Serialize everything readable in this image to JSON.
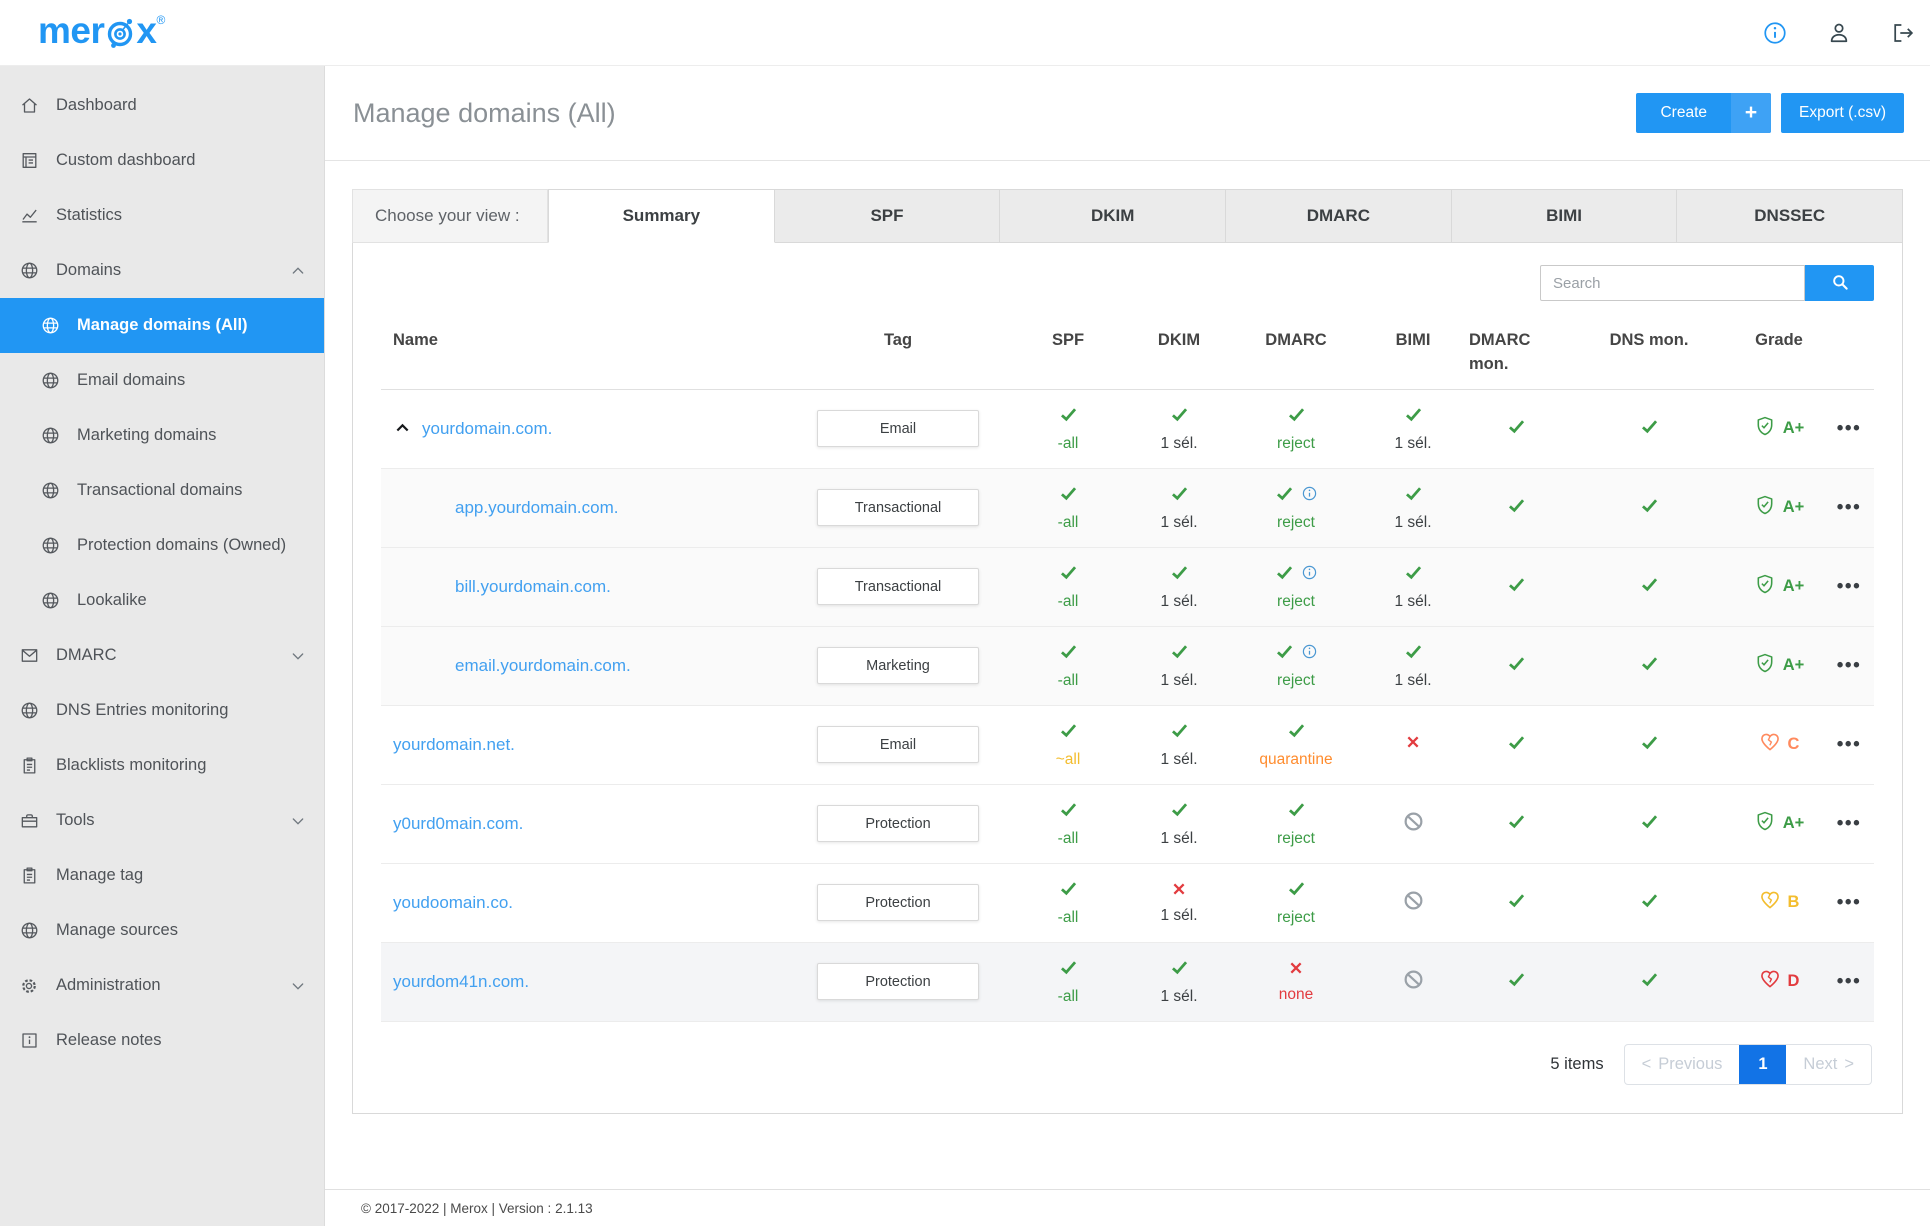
{
  "header": {
    "logo": {
      "pre": "mer",
      "post": "x",
      "mark": "®"
    }
  },
  "sidebar": {
    "items": [
      {
        "label": "Dashboard",
        "icon": "home"
      },
      {
        "label": "Custom dashboard",
        "icon": "document"
      },
      {
        "label": "Statistics",
        "icon": "chart"
      },
      {
        "label": "Domains",
        "icon": "globe",
        "chevron": "up"
      },
      {
        "label": "Manage domains (All)",
        "icon": "globe",
        "sub": true,
        "selected": true
      },
      {
        "label": "Email domains",
        "icon": "globe",
        "sub": true
      },
      {
        "label": "Marketing domains",
        "icon": "globe",
        "sub": true
      },
      {
        "label": "Transactional domains",
        "icon": "globe",
        "sub": true
      },
      {
        "label": "Protection domains (Owned)",
        "icon": "globe",
        "sub": true
      },
      {
        "label": "Lookalike",
        "icon": "globe",
        "sub": true
      },
      {
        "label": "DMARC",
        "icon": "mail",
        "chevron": "down"
      },
      {
        "label": "DNS Entries monitoring",
        "icon": "globe"
      },
      {
        "label": "Blacklists monitoring",
        "icon": "clipboard"
      },
      {
        "label": "Tools",
        "icon": "toolbox",
        "chevron": "down"
      },
      {
        "label": "Manage tag",
        "icon": "clipboard"
      },
      {
        "label": "Manage sources",
        "icon": "globe"
      },
      {
        "label": "Administration",
        "icon": "gear",
        "chevron": "down"
      },
      {
        "label": "Release notes",
        "icon": "info-square"
      }
    ]
  },
  "page": {
    "title": "Manage domains (All)",
    "create_label": "Create",
    "create_plus": "+",
    "export_label": "Export (.csv)"
  },
  "tabs": {
    "caption": "Choose your view :",
    "items": [
      {
        "label": "Summary",
        "active": true
      },
      {
        "label": "SPF"
      },
      {
        "label": "DKIM"
      },
      {
        "label": "DMARC"
      },
      {
        "label": "BIMI"
      },
      {
        "label": "DNSSEC"
      }
    ]
  },
  "search": {
    "placeholder": "Search"
  },
  "table": {
    "columns": [
      "Name",
      "Tag",
      "SPF",
      "DKIM",
      "DMARC",
      "BIMI",
      "DMARC mon.",
      "DNS mon.",
      "Grade",
      ""
    ],
    "rows": [
      {
        "name": "yourdomain.com.",
        "expander": true,
        "indent": false,
        "tag": "Email",
        "shade": "none",
        "spf": {
          "icon": "check",
          "text": "-all",
          "color": "green"
        },
        "dkim": {
          "icon": "check",
          "text": "1 sél.",
          "color": "dark"
        },
        "dmarc": {
          "icon": "check",
          "info": false,
          "text": "reject",
          "color": "green"
        },
        "bimi": {
          "icon": "check",
          "text": "1 sél.",
          "color": "dark"
        },
        "dmarc_mon": {
          "icon": "check"
        },
        "dns_mon": {
          "icon": "check"
        },
        "grade": {
          "icon": "shield",
          "letter": "A+",
          "color": "green"
        }
      },
      {
        "name": "app.yourdomain.com.",
        "expander": false,
        "indent": true,
        "tag": "Transactional",
        "shade": "sub",
        "spf": {
          "icon": "check",
          "text": "-all",
          "color": "green"
        },
        "dkim": {
          "icon": "check",
          "text": "1 sél.",
          "color": "dark"
        },
        "dmarc": {
          "icon": "check",
          "info": true,
          "text": "reject",
          "color": "green"
        },
        "bimi": {
          "icon": "check",
          "text": "1 sél.",
          "color": "dark"
        },
        "dmarc_mon": {
          "icon": "check"
        },
        "dns_mon": {
          "icon": "check"
        },
        "grade": {
          "icon": "shield",
          "letter": "A+",
          "color": "green"
        }
      },
      {
        "name": "bill.yourdomain.com.",
        "expander": false,
        "indent": true,
        "tag": "Transactional",
        "shade": "sub",
        "spf": {
          "icon": "check",
          "text": "-all",
          "color": "green"
        },
        "dkim": {
          "icon": "check",
          "text": "1 sél.",
          "color": "dark"
        },
        "dmarc": {
          "icon": "check",
          "info": true,
          "text": "reject",
          "color": "green"
        },
        "bimi": {
          "icon": "check",
          "text": "1 sél.",
          "color": "dark"
        },
        "dmarc_mon": {
          "icon": "check"
        },
        "dns_mon": {
          "icon": "check"
        },
        "grade": {
          "icon": "shield",
          "letter": "A+",
          "color": "green"
        }
      },
      {
        "name": "email.yourdomain.com.",
        "expander": false,
        "indent": true,
        "tag": "Marketing",
        "shade": "sub",
        "spf": {
          "icon": "check",
          "text": "-all",
          "color": "green"
        },
        "dkim": {
          "icon": "check",
          "text": "1 sél.",
          "color": "dark"
        },
        "dmarc": {
          "icon": "check",
          "info": true,
          "text": "reject",
          "color": "green"
        },
        "bimi": {
          "icon": "check",
          "text": "1 sél.",
          "color": "dark"
        },
        "dmarc_mon": {
          "icon": "check"
        },
        "dns_mon": {
          "icon": "check"
        },
        "grade": {
          "icon": "shield",
          "letter": "A+",
          "color": "green"
        }
      },
      {
        "name": "yourdomain.net.",
        "expander": false,
        "indent": false,
        "tag": "Email",
        "shade": "none",
        "spf": {
          "icon": "check",
          "text": "~all",
          "color": "yellow"
        },
        "dkim": {
          "icon": "check",
          "text": "1 sél.",
          "color": "dark"
        },
        "dmarc": {
          "icon": "check",
          "info": false,
          "text": "quarantine",
          "color": "orange"
        },
        "bimi": {
          "icon": "cross",
          "text": "",
          "color": "dark"
        },
        "dmarc_mon": {
          "icon": "check"
        },
        "dns_mon": {
          "icon": "check"
        },
        "grade": {
          "icon": "broken-heart",
          "letter": "C",
          "color": "coral"
        }
      },
      {
        "name": "y0urd0main.com.",
        "expander": false,
        "indent": false,
        "tag": "Protection",
        "shade": "none",
        "spf": {
          "icon": "check",
          "text": "-all",
          "color": "green"
        },
        "dkim": {
          "icon": "check",
          "text": "1 sél.",
          "color": "dark"
        },
        "dmarc": {
          "icon": "check",
          "info": false,
          "text": "reject",
          "color": "green"
        },
        "bimi": {
          "icon": "blocked",
          "text": "",
          "color": "dark"
        },
        "dmarc_mon": {
          "icon": "check"
        },
        "dns_mon": {
          "icon": "check"
        },
        "grade": {
          "icon": "shield",
          "letter": "A+",
          "color": "green"
        }
      },
      {
        "name": "youdoomain.co.",
        "expander": false,
        "indent": false,
        "tag": "Protection",
        "shade": "none",
        "spf": {
          "icon": "check",
          "text": "-all",
          "color": "green"
        },
        "dkim": {
          "icon": "cross",
          "text": "1 sél.",
          "color": "dark"
        },
        "dmarc": {
          "icon": "check",
          "info": false,
          "text": "reject",
          "color": "green"
        },
        "bimi": {
          "icon": "blocked",
          "text": "",
          "color": "dark"
        },
        "dmarc_mon": {
          "icon": "check"
        },
        "dns_mon": {
          "icon": "check"
        },
        "grade": {
          "icon": "broken-heart",
          "letter": "B",
          "color": "yellow"
        }
      },
      {
        "name": "yourdom41n.com.",
        "expander": false,
        "indent": false,
        "tag": "Protection",
        "shade": "gray",
        "spf": {
          "icon": "check",
          "text": "-all",
          "color": "green"
        },
        "dkim": {
          "icon": "check",
          "text": "1 sél.",
          "color": "dark"
        },
        "dmarc": {
          "icon": "cross",
          "info": false,
          "text": "none",
          "color": "red"
        },
        "bimi": {
          "icon": "blocked",
          "text": "",
          "color": "dark"
        },
        "dmarc_mon": {
          "icon": "check"
        },
        "dns_mon": {
          "icon": "check"
        },
        "grade": {
          "icon": "broken-heart",
          "letter": "D",
          "color": "red"
        }
      }
    ]
  },
  "pagination": {
    "items_label": "5 items",
    "prev_arrow": "<",
    "previous_label": "Previous",
    "page": "1",
    "next_label": "Next",
    "next_arrow": ">"
  },
  "footer": {
    "text": "© 2017-2022 | Merox | Version : 2.1.13"
  },
  "colors": {
    "primary": "#2196f3",
    "green": "#3d9c47",
    "yellow": "#f3bd2e",
    "orange": "#ff8c2e",
    "coral": "#ff8a5e",
    "red": "#e23b3f",
    "dark": "#3c4043",
    "link": "#42a0f0",
    "blocked_gray": "#9aa1a8"
  }
}
